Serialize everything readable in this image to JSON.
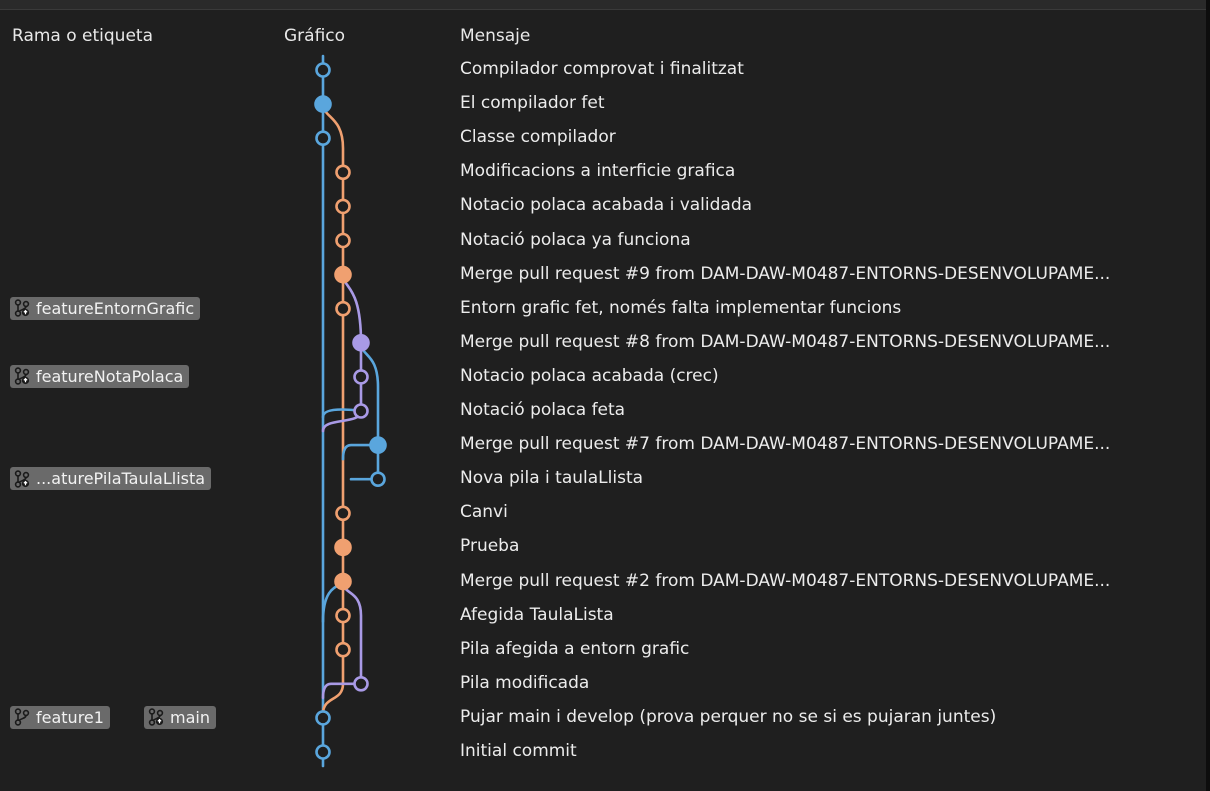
{
  "headers": {
    "branch": "Rama o etiqueta",
    "graph": "Gráfico",
    "message": "Mensaje"
  },
  "colors": {
    "blue": "#5aa6dd",
    "orange": "#f0a070",
    "purple": "#a99ae6",
    "tag_bg": "#6a6a6a"
  },
  "commits": [
    {
      "message": "Compilador comprovat i finalitzat"
    },
    {
      "message": "El compilador fet"
    },
    {
      "message": "Classe compilador"
    },
    {
      "message": "Modificacions a interficie grafica"
    },
    {
      "message": "Notacio polaca acabada i validada"
    },
    {
      "message": "Notació polaca ya funciona"
    },
    {
      "message": "Merge pull request #9 from DAM-DAW-M0487-ENTORNS-DESENVOLUPAME..."
    },
    {
      "message": "Entorn grafic fet, només falta implementar funcions",
      "tags": [
        {
          "label": "featureEntornGrafic",
          "icon": "git-branch-published-icon"
        }
      ]
    },
    {
      "message": "Merge pull request #8 from DAM-DAW-M0487-ENTORNS-DESENVOLUPAME..."
    },
    {
      "message": "Notacio polaca acabada (crec)",
      "tags": [
        {
          "label": "featureNotaPolaca",
          "icon": "git-branch-published-icon"
        }
      ]
    },
    {
      "message": "Notació polaca feta"
    },
    {
      "message": "Merge pull request #7 from DAM-DAW-M0487-ENTORNS-DESENVOLUPAME..."
    },
    {
      "message": "Nova pila i taulaLlista",
      "tags": [
        {
          "label": "...aturePilaTaulaLlista",
          "icon": "git-branch-published-icon"
        }
      ]
    },
    {
      "message": "Canvi"
    },
    {
      "message": "Prueba"
    },
    {
      "message": "Merge pull request #2 from DAM-DAW-M0487-ENTORNS-DESENVOLUPAME..."
    },
    {
      "message": "Afegida TaulaLista"
    },
    {
      "message": "Pila afegida a entorn grafic"
    },
    {
      "message": "Pila modificada"
    },
    {
      "message": "Pujar main i develop (prova perquer no se si es pujaran juntes)",
      "tags": [
        {
          "label": "feature1",
          "icon": "git-branch-icon"
        },
        {
          "label": "main",
          "icon": "git-branch-published-icon"
        }
      ]
    },
    {
      "message": "Initial commit"
    }
  ]
}
